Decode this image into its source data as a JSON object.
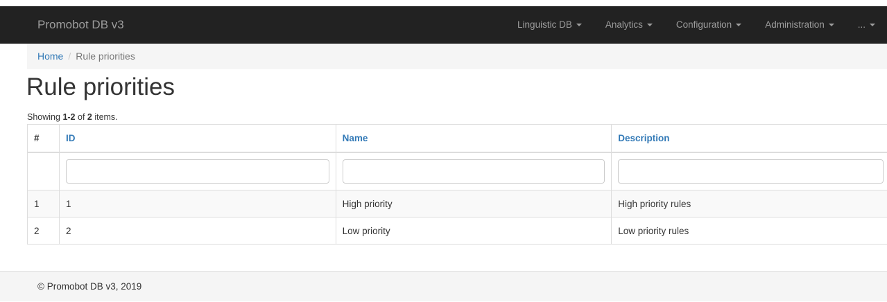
{
  "navbar": {
    "brand": "Promobot DB v3",
    "items": [
      {
        "label": "Linguistic DB"
      },
      {
        "label": "Analytics"
      },
      {
        "label": "Configuration"
      },
      {
        "label": "Administration"
      },
      {
        "label": "..."
      }
    ]
  },
  "breadcrumb": {
    "home": "Home",
    "separator": "/",
    "current": "Rule priorities"
  },
  "page": {
    "title": "Rule priorities"
  },
  "summary": {
    "prefix": "Showing ",
    "range": "1-2",
    "middle": " of ",
    "total": "2",
    "suffix": " items."
  },
  "table": {
    "headers": {
      "num": "#",
      "id": "ID",
      "name": "Name",
      "description": "Description"
    },
    "filters": {
      "id": "",
      "name": "",
      "description": ""
    },
    "rows": [
      {
        "num": "1",
        "id": "1",
        "name": "High priority",
        "description": "High priority rules"
      },
      {
        "num": "2",
        "id": "2",
        "name": "Low priority",
        "description": "Low priority rules"
      }
    ]
  },
  "footer": {
    "text": "© Promobot DB v3, 2019"
  }
}
